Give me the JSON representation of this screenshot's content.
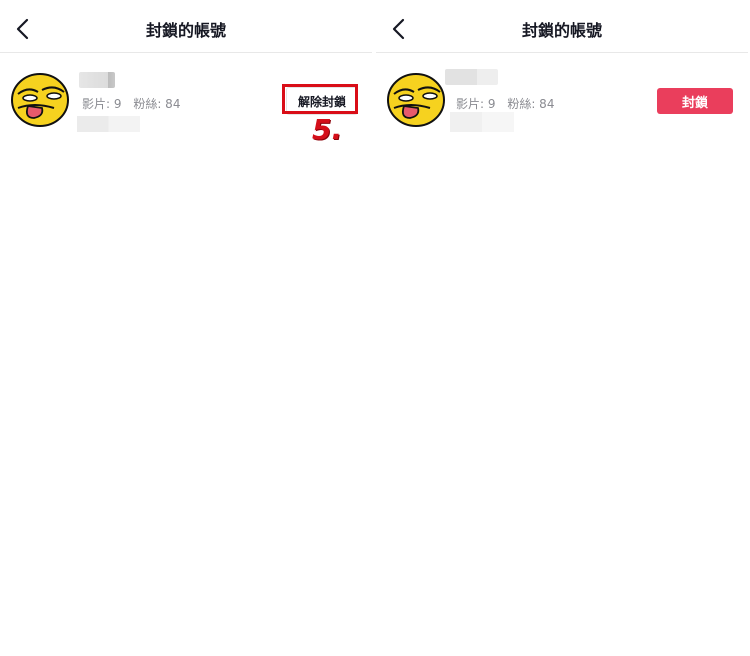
{
  "colors": {
    "block_button": "#ea3e5c",
    "highlight": "#d90d17",
    "divider": "#e8e8e8",
    "secondary_text": "#8a8b91"
  },
  "left": {
    "header": {
      "title": "封鎖的帳號",
      "back_icon": "chevron-left-icon"
    },
    "user": {
      "avatar_icon": "yellow-face-avatar",
      "videos": "影片: 9",
      "followers": "粉絲: 84",
      "action_label": "解除封鎖"
    },
    "annotation": {
      "step": "5."
    }
  },
  "right": {
    "header": {
      "title": "封鎖的帳號",
      "back_icon": "chevron-left-icon"
    },
    "user": {
      "avatar_icon": "yellow-face-avatar",
      "videos": "影片: 9",
      "followers": "粉絲: 84",
      "action_label": "封鎖"
    }
  }
}
